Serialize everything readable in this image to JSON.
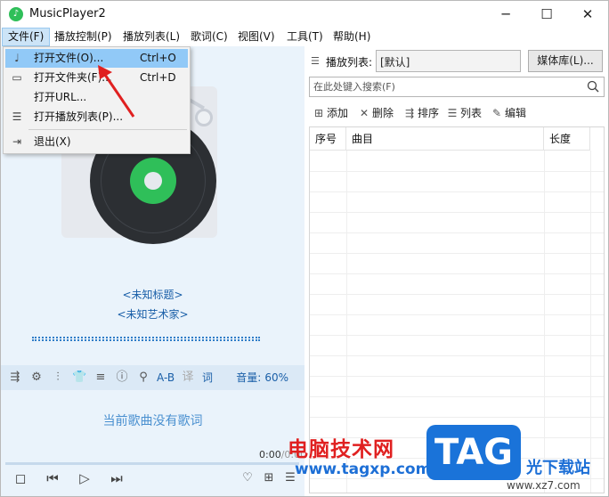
{
  "window": {
    "title": "MusicPlayer2",
    "min": "─",
    "max": "☐",
    "close": "✕"
  },
  "menubar": {
    "items": [
      {
        "label": "文件(F)"
      },
      {
        "label": "播放控制(P)"
      },
      {
        "label": "播放列表(L)"
      },
      {
        "label": "歌词(C)"
      },
      {
        "label": "视图(V)"
      },
      {
        "label": "工具(T)"
      },
      {
        "label": "帮助(H)"
      }
    ]
  },
  "file_menu": {
    "items": [
      {
        "label": "打开文件(O)...",
        "shortcut": "Ctrl+O",
        "icon": "music-note-icon"
      },
      {
        "label": "打开文件夹(F)...",
        "shortcut": "Ctrl+D",
        "icon": "folder-icon"
      },
      {
        "label": "打开URL...",
        "shortcut": "",
        "icon": ""
      },
      {
        "label": "打开播放列表(P)...",
        "shortcut": "",
        "icon": "playlist-icon"
      },
      {
        "label": "退出(X)",
        "shortcut": "",
        "icon": "exit-icon"
      }
    ]
  },
  "now_playing": {
    "title": "<未知标题>",
    "artist": "<未知艺术家>",
    "lyric_btn": "词",
    "ab_label": "A-B",
    "volume_label": "音量:",
    "volume_value": "60%",
    "no_lyrics": "当前歌曲没有歌词",
    "time_current": "0:00",
    "time_total": "0:00",
    "progress": 0
  },
  "playlist": {
    "label": "播放列表:",
    "current": "[默认]",
    "media_lib_btn": "媒体库(L)...",
    "search_placeholder": "在此处键入搜索(F)",
    "toolbar": {
      "add": "添加",
      "delete": "删除",
      "sort": "排序",
      "list": "列表",
      "edit": "编辑"
    },
    "columns": [
      "序号",
      "曲目",
      "长度"
    ]
  },
  "watermark": {
    "text": "电脑技术网",
    "url": "www.tagxp.com",
    "tag": "TAG",
    "site": "光下载站",
    "site_url": "www.xz7.com"
  },
  "colors": {
    "accent": "#1a5fa8",
    "vinyl_label": "#2fbf59",
    "menu_highlight": "#91c9f7",
    "watermark_red": "#e02020"
  }
}
